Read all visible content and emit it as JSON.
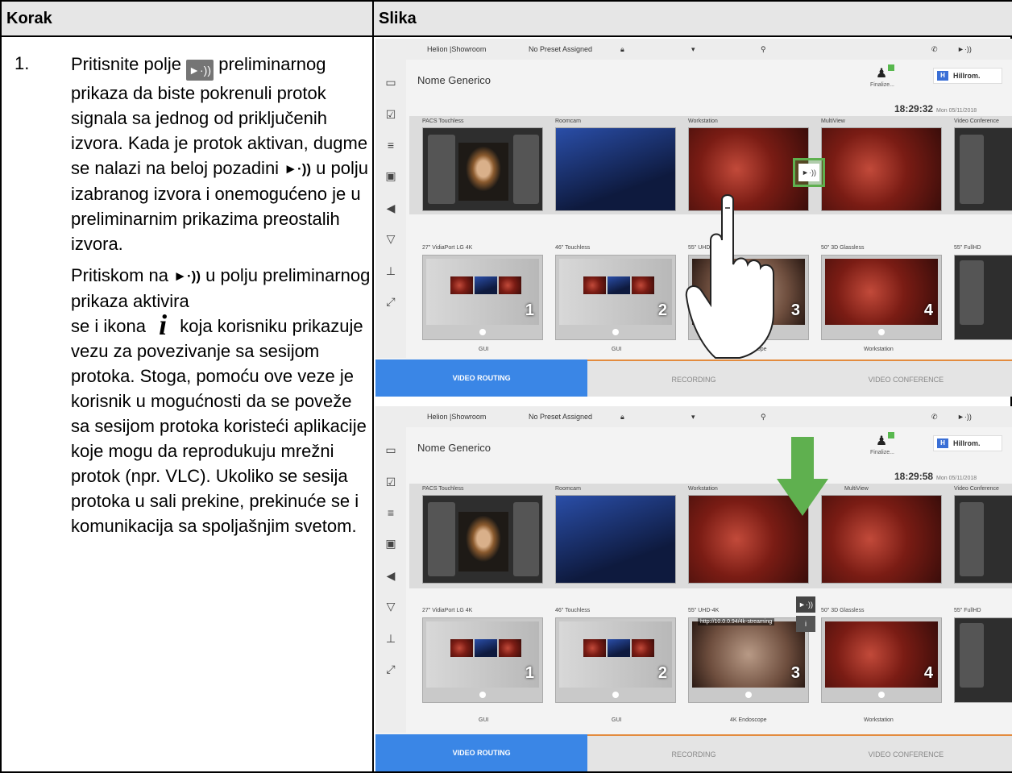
{
  "header": {
    "col1": "Korak",
    "col2": "Slika"
  },
  "step": {
    "number": "1.",
    "p1_a": "Pritisnite polje",
    "p1_b": "preliminarnog prikaza da biste pokrenuli protok signala sa jednog od priključenih izvora. Kada je protok aktivan, dugme",
    "p1_c": "se nalazi na beloj pozadini",
    "p1_d": "u polju izabranog izvora i onemogućeno je u preliminarnim prikazima preostalih izvora.",
    "p2_a": "Pritiskom na",
    "p2_b": "u polju preliminarnog prikaza aktivira",
    "p2_c": "se i ikona",
    "p2_d": "koja korisniku prikazuje vezu za povezivanje sa sesijom protoka. Stoga, pomoću ove veze je korisnik u mogućnosti da se poveže sa sesijom protoka koristeći aplikacije koje mogu da reprodukuju mrežni protok (npr. VLC). Ukoliko se sesija protoka u sali prekine, prekinuće se i komunikacija sa spoljašnjim svetom.",
    "icon_stream": "►·))",
    "icon_info": "i"
  },
  "screens": [
    {
      "room": "Helion |Showroom",
      "preset": "No Preset Assigned",
      "title": "Nome Generico",
      "time": "18:29:32",
      "date": "Mon 05/11/2018",
      "brand": "Hillrom.",
      "finalize": "Finalize...",
      "sources": [
        "PACS Touchless",
        "Roomcam",
        "Workstation",
        "MultiView",
        "Video Conference"
      ],
      "displays": [
        "27\" VidiaPort LG 4K",
        "46\" Touchless",
        "55\" UHD 4K",
        "50\" 3D Glassless",
        "55\" FullHD"
      ],
      "display_sources": [
        "GUI",
        "GUI",
        "4K Endoscope",
        "Workstation"
      ],
      "display_numbers": [
        "1",
        "2",
        "3",
        "4"
      ],
      "tabs": [
        "VIDEO ROUTING",
        "RECORDING",
        "VIDEO CONFERENCE"
      ],
      "stream_button": "►·))"
    },
    {
      "room": "Helion |Showroom",
      "preset": "No Preset Assigned",
      "title": "Nome Generico",
      "time": "18:29:58",
      "date": "Mon 05/11/2018",
      "brand": "Hillrom.",
      "finalize": "Finalize...",
      "sources": [
        "PACS Touchless",
        "Roomcam",
        "Workstation",
        "MultiView",
        "Video Conference"
      ],
      "displays": [
        "27\" VidiaPort LG 4K",
        "46\" Touchless",
        "55\" UHD-4K",
        "50\" 3D Glassless",
        "55\" FullHD"
      ],
      "display_sources": [
        "GUI",
        "GUI",
        "4K Endoscope",
        "Workstation"
      ],
      "display_numbers": [
        "1",
        "2",
        "3",
        "4"
      ],
      "tabs": [
        "VIDEO ROUTING",
        "RECORDING",
        "VIDEO CONFERENCE"
      ],
      "stream_url": "http://10.0.0.94/4k-streaming",
      "stream_button": "►·))",
      "info_button": "i"
    }
  ],
  "colors": {
    "accent": "#3a86e6",
    "highlight": "#5fb04f",
    "tab_border": "#e38b3e"
  }
}
